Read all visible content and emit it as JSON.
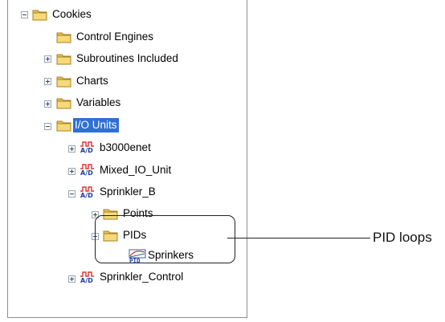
{
  "tree": {
    "root_label": "Cookies",
    "control_engines": "Control Engines",
    "subroutines": "Subroutines Included",
    "charts": "Charts",
    "variables": "Variables",
    "io_units": "I/O Units",
    "b3000enet": "b3000enet",
    "mixed_io": "Mixed_IO_Unit",
    "sprinkler_b": "Sprinkler_B",
    "points": "Points",
    "pids": "PIDs",
    "sprinkers": "Sprinkers",
    "sprinkler_control": "Sprinkler_Control"
  },
  "callout": {
    "label": "PID loops"
  },
  "icons": {
    "folder": "folder-icon",
    "io_unit": "io-unit-icon",
    "pid": "pid-icon"
  }
}
